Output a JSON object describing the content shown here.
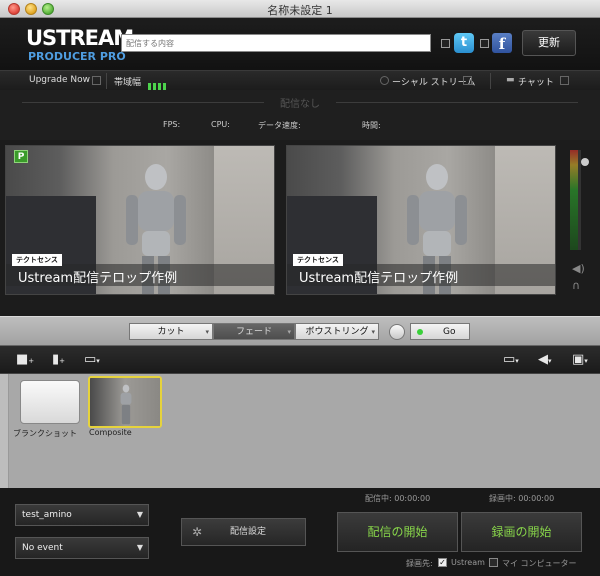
{
  "window": {
    "title": "名称未設定 1"
  },
  "header": {
    "logo_top": "USTREAM",
    "logo_bottom": "PRODUCER PRO",
    "title_placeholder": "配信する内容",
    "twitter_icon": "t",
    "facebook_icon": "f",
    "update_label": "更新"
  },
  "status_row": {
    "upgrade_label": "Upgrade Now",
    "bandwidth_label": "帯域幅",
    "social_label": "ーシャル ストリーム",
    "chat_label": "チャット"
  },
  "info": {
    "onair_status": "配信なし",
    "fps_label": "FPS:",
    "cpu_label": "CPU:",
    "data_rate_label": "データ速度:",
    "time_label": "時間:"
  },
  "previews": [
    {
      "badge": "P",
      "lower_third_label": "テクトセンス",
      "lower_third_text": "Ustream配信テロップ作例"
    },
    {
      "lower_third_label": "テクトセンス",
      "lower_third_text": "Ustream配信テロップ作例"
    }
  ],
  "transition": {
    "cut_label": "カット",
    "fade_label": "フェード",
    "wipe_label": "ボウストリング",
    "go_label": "Go"
  },
  "media": {
    "items": [
      {
        "label": "ブランクショット"
      },
      {
        "label": "Composite"
      }
    ]
  },
  "bottom": {
    "broadcasting_time": "配信中: 00:00:00",
    "recording_time": "録画中: 00:00:00",
    "account_value": "test_amino",
    "event_value": "No event",
    "settings_label": "配信設定",
    "start_broadcast_label": "配信の開始",
    "start_recording_label": "録画の開始",
    "record_target_label": "録画先:",
    "ustream_option": "Ustream",
    "mycomputer_option": "マイ コンピューター"
  },
  "colors": {
    "accent_green": "#88d64a",
    "selection_yellow": "#e6d33c"
  }
}
